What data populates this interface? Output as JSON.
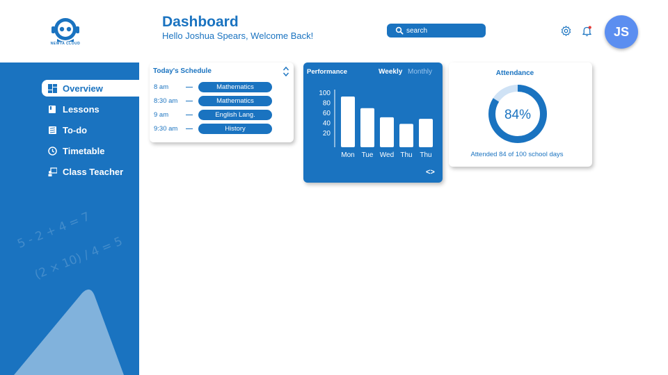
{
  "brand": {
    "logo_text": "NEWYA CLOUD"
  },
  "header": {
    "title": "Dashboard",
    "subtitle": "Hello Joshua Spears, Welcome Back!",
    "search_placeholder": "search",
    "avatar_initials": "JS",
    "notification_dot_color": "#e53935"
  },
  "sidebar": {
    "items": [
      {
        "label": "Overview",
        "icon": "dashboard-icon",
        "active": true
      },
      {
        "label": "Lessons",
        "icon": "book-icon",
        "active": false
      },
      {
        "label": "To-do",
        "icon": "checklist-icon",
        "active": false
      },
      {
        "label": "Timetable",
        "icon": "clock-icon",
        "active": false
      },
      {
        "label": "Class Teacher",
        "icon": "teacher-icon",
        "active": false
      }
    ],
    "decor": [
      "5 - 2 + 4 = 7",
      "(2 × 10) / 4 = 5"
    ]
  },
  "schedule": {
    "title": "Today's Schedule",
    "rows": [
      {
        "time": "8 am",
        "subject": "Mathematics"
      },
      {
        "time": "8:30 am",
        "subject": "Mathematics"
      },
      {
        "time": "9 am",
        "subject": "English Lang."
      },
      {
        "time": "9:30 am",
        "subject": "History"
      }
    ]
  },
  "performance": {
    "title": "Performance",
    "tab_weekly": "Weekly",
    "tab_monthly": "Monthly",
    "nav_label": "<>"
  },
  "attendance": {
    "title": "Attendance",
    "percent_label": "84%",
    "percent": 84,
    "note": "Attended 84 of 100 school days"
  },
  "colors": {
    "primary": "#1a73c0",
    "avatar": "#5b8ef0",
    "track": "#cfe2f5"
  },
  "chart_data": {
    "type": "bar",
    "categories": [
      "Mon",
      "Tue",
      "Wed",
      "Thu",
      "Thu"
    ],
    "values": [
      100,
      77,
      59,
      46,
      56
    ],
    "yticks": [
      100,
      80,
      60,
      40,
      20
    ],
    "ylim": [
      0,
      100
    ],
    "grid": false
  }
}
